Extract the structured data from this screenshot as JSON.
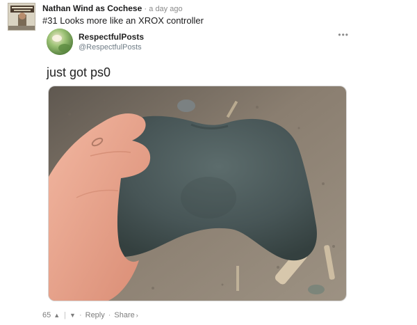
{
  "comment": {
    "author": "Nathan Wind as Cochese",
    "separator": "·",
    "time": "a day ago",
    "body": "#31 Looks more like an XROX controller"
  },
  "tweet": {
    "name": "RespectfulPosts",
    "handle": "@RespectfulPosts",
    "more_label": "•••",
    "text": "just got ps0"
  },
  "actions": {
    "score": "65",
    "upvote_icon": "chevron-up",
    "downvote_icon": "chevron-down",
    "divider": "|",
    "dot": "·",
    "reply_label": "Reply",
    "share_label": "Share",
    "share_chevron": "›"
  },
  "colors": {
    "sand": "#8c7f6e",
    "stone": "#4d5b5c",
    "skin": "#e7a58e"
  }
}
